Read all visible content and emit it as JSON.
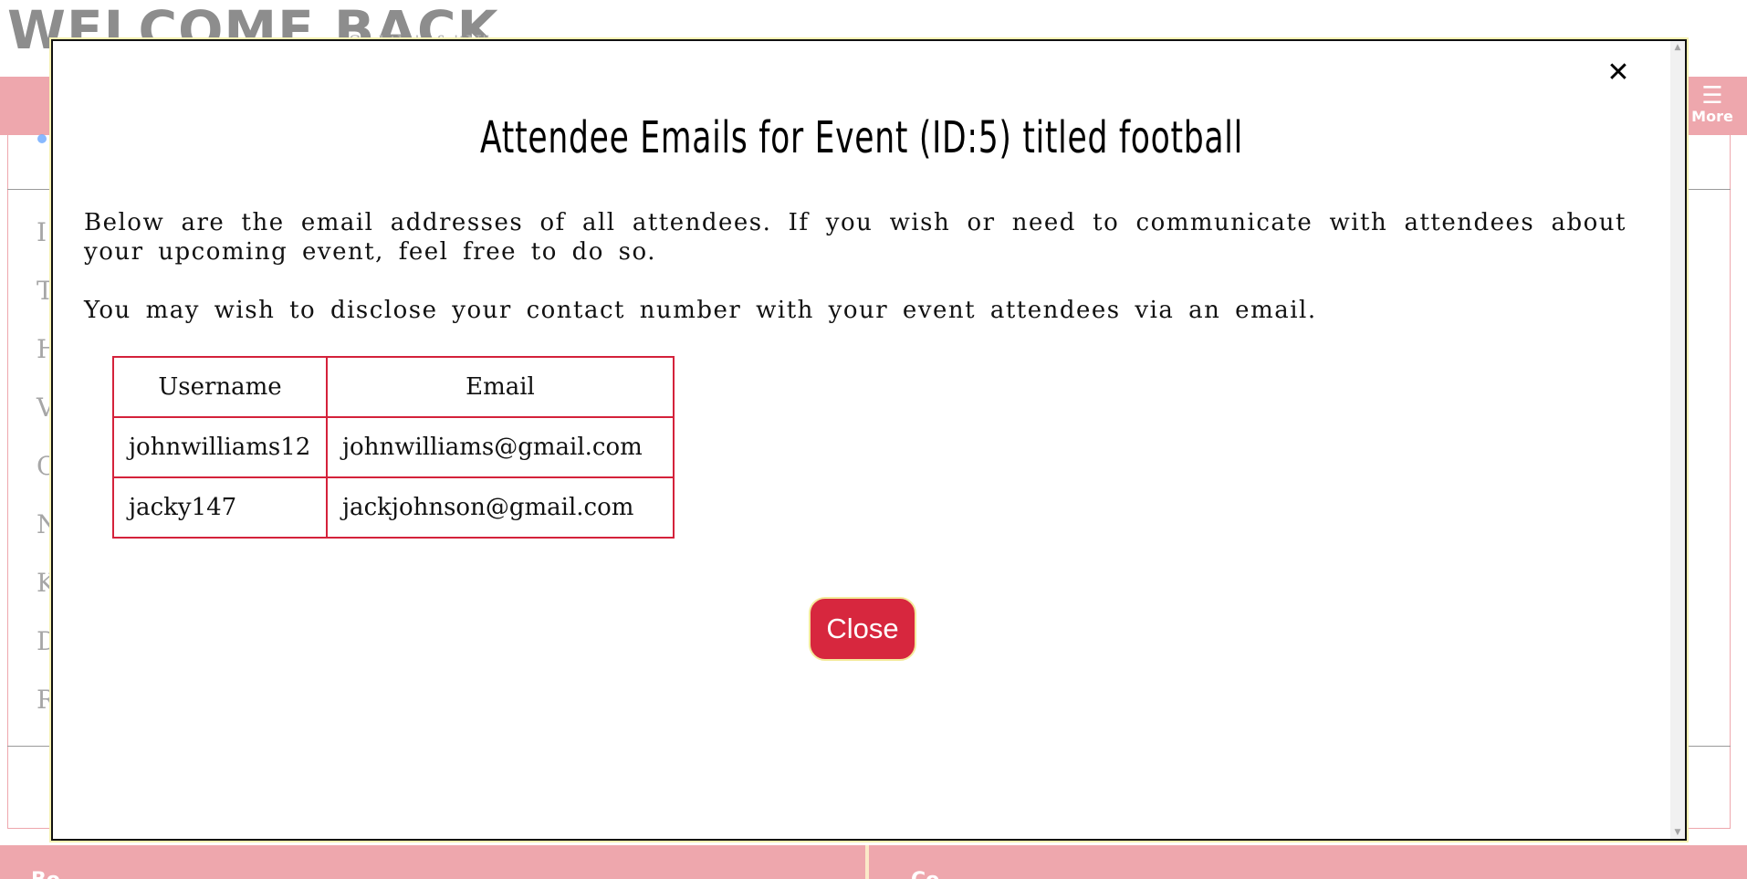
{
  "background": {
    "welcome": "WELCOME BACK,",
    "subtitle": "Su ktb 'y fo'tN\"",
    "more_label": "More",
    "burger_glyph": "☰",
    "row_letters": [
      "I",
      "T",
      "H",
      "V",
      "C",
      "N",
      "K",
      "D",
      "R"
    ],
    "footer_left": "Bo",
    "footer_right": "Co"
  },
  "modal": {
    "close_glyph": "✕",
    "title": "Attendee Emails for Event (ID:5) titled football",
    "paragraph1": "Below are the email addresses of all attendees. If you wish or need to communicate with attendees about your upcoming event, feel free to do so.",
    "paragraph2": "You may wish to disclose your contact number with your event attendees via an email.",
    "table": {
      "headers": [
        "Username",
        "Email"
      ],
      "rows": [
        [
          "johnwilliams12",
          "johnwilliams@gmail.com"
        ],
        [
          "jacky147",
          "jackjohnson@gmail.com"
        ]
      ]
    },
    "close_button": "Close",
    "scroll_up_glyph": "▲",
    "scroll_down_glyph": "▼"
  },
  "colors": {
    "accent_red": "#d7273e",
    "nav_pink": "#eea7ad",
    "table_border": "#d4223b"
  }
}
